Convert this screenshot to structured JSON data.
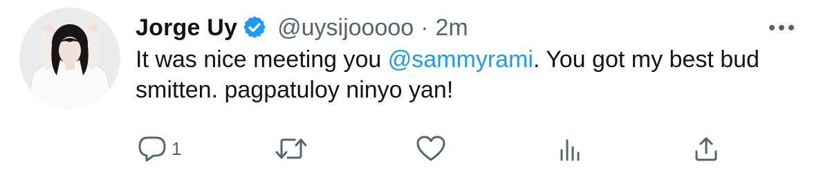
{
  "tweet": {
    "author": {
      "display_name": "Jorge Uy",
      "handle": "@uysijooooo",
      "verified_icon": "verified-badge-icon",
      "avatar": "avatar-image"
    },
    "separator": "·",
    "time": "2m",
    "text": {
      "before_mention": "It was nice meeting you ",
      "mention": "@sammyrami",
      "after_mention": ". You got my best bud smitten. pagpatuloy ninyo yan!"
    },
    "more_icon": "more-horizontal-icon",
    "actions": {
      "reply": {
        "icon": "reply-icon",
        "count": "1"
      },
      "retweet": {
        "icon": "retweet-icon"
      },
      "like": {
        "icon": "heart-icon"
      },
      "views": {
        "icon": "analytics-icon"
      },
      "share": {
        "icon": "share-icon"
      }
    }
  },
  "colors": {
    "text": "#0f1419",
    "secondary": "#536471",
    "accent": "#1d9bf0"
  }
}
